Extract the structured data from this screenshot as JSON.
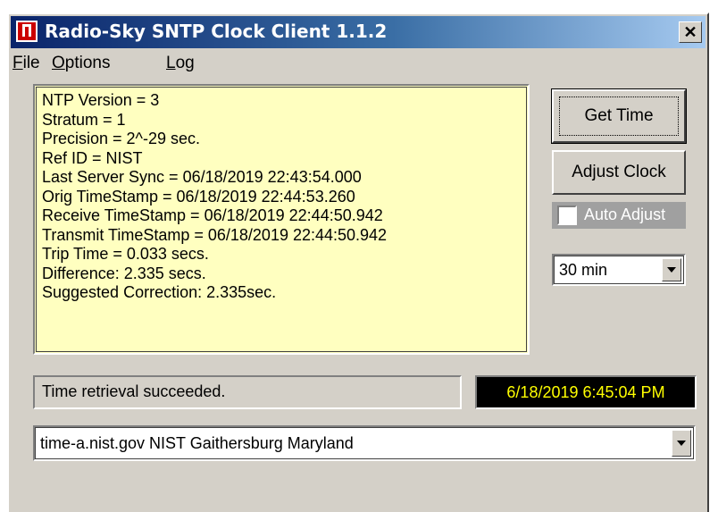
{
  "window": {
    "title": "Radio-Sky SNTP Clock Client  1.1.2",
    "close_glyph": "✕"
  },
  "menu": [
    {
      "first": "F",
      "rest": "ile"
    },
    {
      "first": "O",
      "rest": "ptions"
    },
    {
      "first": "L",
      "rest": "og"
    }
  ],
  "info": {
    "lines": [
      "NTP Version =  3",
      "Stratum =  1",
      "Precision = 2^-29 sec.",
      "Ref ID = NIST",
      "Last Server Sync = 06/18/2019  22:43:54.000",
      "Orig TimeStamp = 06/18/2019  22:44:53.260",
      "Receive TimeStamp = 06/18/2019  22:44:50.942",
      "Transmit TimeStamp = 06/18/2019  22:44:50.942",
      "Trip Time = 0.033 secs.",
      "Difference: 2.335 secs.",
      "Suggested Correction: 2.335sec."
    ]
  },
  "buttons": {
    "get_time": "Get Time",
    "adjust_clock": "Adjust Clock"
  },
  "auto_adjust": {
    "label": "Auto Adjust",
    "checked": false
  },
  "interval": {
    "selected": "30 min"
  },
  "status": {
    "message": "Time retrieval succeeded.",
    "clock": "6/18/2019 6:45:04 PM"
  },
  "server": {
    "selected": "time-a.nist.gov NIST Gaithersburg Maryland"
  },
  "icons": {
    "app": "app-icon",
    "close": "close-icon",
    "dropdown": "chevron-down-icon"
  },
  "colors": {
    "title_gradient_start": "#0a246a",
    "title_gradient_end": "#a6caf0",
    "info_background": "#ffffc0",
    "clock_background": "#000000",
    "clock_text": "#ffff00",
    "face": "#d4d0c8"
  }
}
